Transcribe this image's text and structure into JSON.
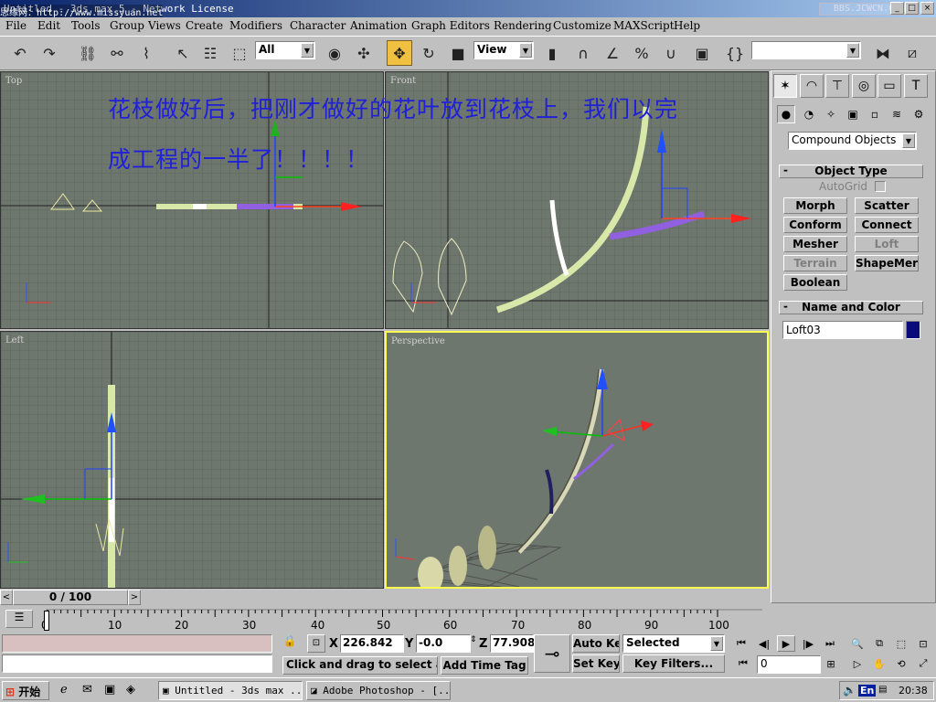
{
  "window": {
    "title": "Untitled - 3ds max 5 - Network License",
    "watermark_left": "思缘网：http://www.missyuan.net",
    "watermark_right": "BBS.JCWCN.COM",
    "controls": [
      "_",
      "□",
      "×"
    ]
  },
  "menu": [
    "File",
    "Edit",
    "Tools",
    "Group",
    "Views",
    "Create",
    "Modifiers",
    "Character",
    "Animation",
    "Graph Editors",
    "Rendering",
    "Customize",
    "MAXScript",
    "Help"
  ],
  "toolbar": {
    "selection_filter": "All",
    "ref_coord": "View",
    "named_selection": ""
  },
  "viewports": {
    "top": {
      "label": "Top"
    },
    "front": {
      "label": "Front"
    },
    "left": {
      "label": "Left"
    },
    "perspective": {
      "label": "Perspective"
    }
  },
  "annotation": {
    "line1": "花枝做好后，把刚才做好的花叶放到花枝上，我们以完",
    "line2": "成工程的一半了！！！！"
  },
  "command_panel": {
    "category": "Compound Objects",
    "object_type_header": "Object Type",
    "autogrid_label": "AutoGrid",
    "buttons": [
      {
        "label": "Morph",
        "enabled": true
      },
      {
        "label": "Scatter",
        "enabled": true
      },
      {
        "label": "Conform",
        "enabled": true
      },
      {
        "label": "Connect",
        "enabled": true
      },
      {
        "label": "Mesher",
        "enabled": true
      },
      {
        "label": "Loft",
        "enabled": false
      },
      {
        "label": "Terrain",
        "enabled": false
      },
      {
        "label": "ShapeMerge",
        "enabled": true
      },
      {
        "label": "Boolean",
        "enabled": true
      }
    ],
    "name_color_header": "Name and Color",
    "object_name": "Loft03",
    "object_color": "#0a0a7a"
  },
  "time": {
    "slider_label": "0 / 100",
    "ticks": [
      "0",
      "10",
      "20",
      "30",
      "40",
      "50",
      "60",
      "70",
      "80",
      "90",
      "100"
    ]
  },
  "status": {
    "x_label": "X",
    "x_value": "226.842",
    "y_label": "Y",
    "y_value": "-0.0",
    "z_label": "Z",
    "z_value": "77.908",
    "prompt": "Click and drag to select ar",
    "add_time_tag": "Add Time Tag",
    "auto_key": "Auto Key",
    "set_key": "Set Key",
    "key_mode": "Selected",
    "key_filters": "Key Filters...",
    "current_frame": "0"
  },
  "taskbar": {
    "start": "开始",
    "tasks": [
      "Untitled - 3ds max ...",
      "Adobe Photoshop - [..."
    ],
    "lang": "En",
    "clock": "20:38"
  },
  "colors": {
    "viewport_bg": "#6e776e",
    "annotation": "#2020d8",
    "active_viewport": "#ffff50",
    "stem": "#d8e8a8",
    "purple_leaf": "#9060e0"
  }
}
